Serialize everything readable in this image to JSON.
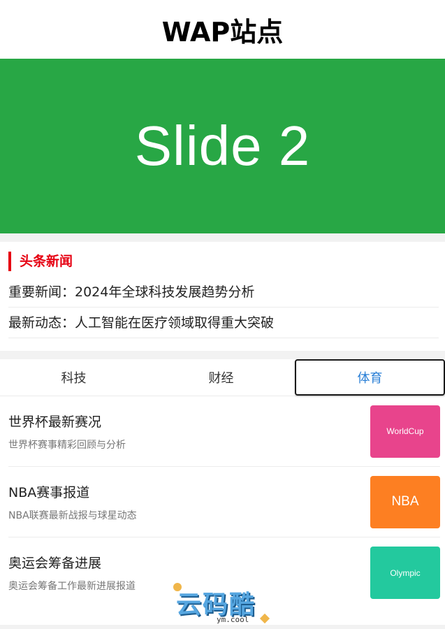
{
  "header": {
    "title": "WAP站点"
  },
  "slider": {
    "current_slide": "Slide 2",
    "color": "#28a745"
  },
  "headlines": {
    "title": "头条新闻",
    "items": [
      "重要新闻：2024年全球科技发展趋势分析",
      "最新动态：人工智能在医疗领域取得重大突破"
    ]
  },
  "tabs": [
    {
      "label": "科技",
      "active": false
    },
    {
      "label": "财经",
      "active": false
    },
    {
      "label": "体育",
      "active": true
    }
  ],
  "articles": [
    {
      "title": "世界杯最新赛况",
      "desc": "世界杯赛事精彩回顾与分析",
      "thumb": "WorldCup",
      "thumb_color": "#e8448c"
    },
    {
      "title": "NBA赛事报道",
      "desc": "NBA联赛最新战报与球星动态",
      "thumb": "NBA",
      "thumb_color": "#fd7f22"
    },
    {
      "title": "奥运会筹备进展",
      "desc": "奥运会筹备工作最新进展报道",
      "thumb": "Olympic",
      "thumb_color": "#23c99e"
    }
  ],
  "watermark": {
    "main": "云码酷",
    "sub": "ym.cool"
  }
}
